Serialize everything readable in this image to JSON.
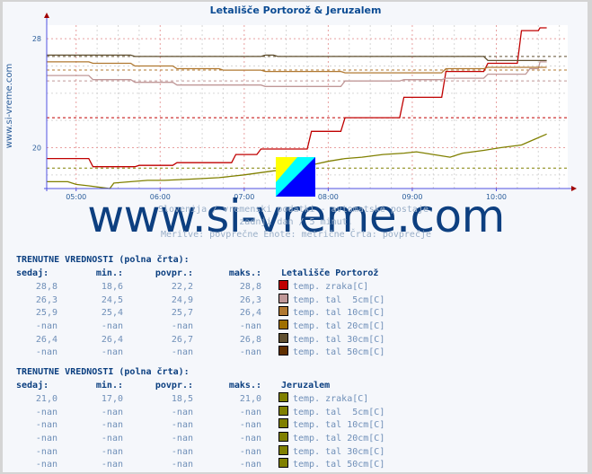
{
  "chart_data": {
    "type": "line",
    "title": "Letališče Portorož & Jeruzalem",
    "side_label": "www.si-vreme.com",
    "xlabel": "",
    "ylabel": "",
    "x_ticks": [
      "05:00",
      "06:00",
      "07:00",
      "08:00",
      "09:00",
      "10:00"
    ],
    "x_range_hours": [
      4.65,
      10.6
    ],
    "y_ticks": [
      20,
      28
    ],
    "ylim": [
      17,
      29
    ],
    "grid": true,
    "series": [
      {
        "name": "Letališče Portorož temp. zraka[C]",
        "color": "#c00000",
        "avg": 22.2,
        "points": [
          [
            4.65,
            19.2
          ],
          [
            5.15,
            19.2
          ],
          [
            5.2,
            18.6
          ],
          [
            5.7,
            18.6
          ],
          [
            5.75,
            18.7
          ],
          [
            6.15,
            18.7
          ],
          [
            6.2,
            18.9
          ],
          [
            6.85,
            18.9
          ],
          [
            6.9,
            19.5
          ],
          [
            7.15,
            19.5
          ],
          [
            7.2,
            19.9
          ],
          [
            7.75,
            19.9
          ],
          [
            7.8,
            21.2
          ],
          [
            8.15,
            21.2
          ],
          [
            8.2,
            22.2
          ],
          [
            8.85,
            22.2
          ],
          [
            8.9,
            23.7
          ],
          [
            9.35,
            23.7
          ],
          [
            9.4,
            25.6
          ],
          [
            9.85,
            25.6
          ],
          [
            9.9,
            26.2
          ],
          [
            10.25,
            26.2
          ],
          [
            10.3,
            28.6
          ],
          [
            10.5,
            28.6
          ],
          [
            10.52,
            28.8
          ],
          [
            10.6,
            28.8
          ]
        ]
      },
      {
        "name": "Letališče Portorož temp. tal 5cm[C]",
        "color": "#c09898",
        "avg": 24.9,
        "points": [
          [
            4.65,
            25.3
          ],
          [
            5.15,
            25.3
          ],
          [
            5.2,
            25.0
          ],
          [
            5.65,
            25.0
          ],
          [
            5.7,
            24.8
          ],
          [
            6.15,
            24.8
          ],
          [
            6.2,
            24.6
          ],
          [
            7.2,
            24.6
          ],
          [
            7.25,
            24.5
          ],
          [
            8.15,
            24.5
          ],
          [
            8.2,
            24.9
          ],
          [
            8.85,
            24.9
          ],
          [
            8.9,
            25.0
          ],
          [
            9.35,
            25.0
          ],
          [
            9.4,
            25.1
          ],
          [
            9.85,
            25.1
          ],
          [
            9.9,
            25.4
          ],
          [
            10.35,
            25.4
          ],
          [
            10.4,
            25.8
          ],
          [
            10.5,
            25.8
          ],
          [
            10.52,
            26.3
          ],
          [
            10.6,
            26.3
          ]
        ]
      },
      {
        "name": "Letališče Portorož temp. tal 10cm[C]",
        "color": "#b07830",
        "avg": 25.7,
        "points": [
          [
            4.65,
            26.3
          ],
          [
            5.15,
            26.3
          ],
          [
            5.2,
            26.2
          ],
          [
            5.65,
            26.2
          ],
          [
            5.7,
            26.0
          ],
          [
            6.15,
            26.0
          ],
          [
            6.2,
            25.8
          ],
          [
            6.7,
            25.8
          ],
          [
            6.75,
            25.7
          ],
          [
            7.2,
            25.7
          ],
          [
            7.25,
            25.6
          ],
          [
            8.15,
            25.6
          ],
          [
            8.2,
            25.5
          ],
          [
            9.35,
            25.5
          ],
          [
            9.4,
            25.8
          ],
          [
            9.85,
            25.8
          ],
          [
            9.9,
            25.9
          ],
          [
            10.6,
            25.9
          ]
        ]
      },
      {
        "name": "Letališče Portorož temp. tal 20cm[C]",
        "color": "#a07000",
        "avg": null,
        "points": []
      },
      {
        "name": "Letališče Portorož temp. tal 30cm[C]",
        "color": "#605030",
        "avg": 26.7,
        "points": [
          [
            4.65,
            26.8
          ],
          [
            5.65,
            26.8
          ],
          [
            5.7,
            26.7
          ],
          [
            7.2,
            26.7
          ],
          [
            7.25,
            26.8
          ],
          [
            7.35,
            26.8
          ],
          [
            7.4,
            26.7
          ],
          [
            9.85,
            26.7
          ],
          [
            9.9,
            26.4
          ],
          [
            10.35,
            26.4
          ],
          [
            10.4,
            26.4
          ],
          [
            10.6,
            26.4
          ]
        ]
      },
      {
        "name": "Letališče Portorož temp. tal 50cm[C]",
        "color": "#603000",
        "avg": null,
        "points": []
      },
      {
        "name": "Jeruzalem temp. zraka[C]",
        "color": "#808000",
        "avg": 18.5,
        "points": [
          [
            4.65,
            17.5
          ],
          [
            4.9,
            17.5
          ],
          [
            5.0,
            17.3
          ],
          [
            5.15,
            17.2
          ],
          [
            5.4,
            17.0
          ],
          [
            5.45,
            17.4
          ],
          [
            5.65,
            17.5
          ],
          [
            5.85,
            17.6
          ],
          [
            6.05,
            17.6
          ],
          [
            6.4,
            17.7
          ],
          [
            6.7,
            17.8
          ],
          [
            7.0,
            18.0
          ],
          [
            7.35,
            18.3
          ],
          [
            7.5,
            18.4
          ],
          [
            7.7,
            18.6
          ],
          [
            7.85,
            18.8
          ],
          [
            8.0,
            19.0
          ],
          [
            8.2,
            19.2
          ],
          [
            8.4,
            19.3
          ],
          [
            8.65,
            19.5
          ],
          [
            8.9,
            19.6
          ],
          [
            9.05,
            19.7
          ],
          [
            9.25,
            19.5
          ],
          [
            9.45,
            19.3
          ],
          [
            9.6,
            19.6
          ],
          [
            9.85,
            19.8
          ],
          [
            10.05,
            20.0
          ],
          [
            10.3,
            20.2
          ],
          [
            10.45,
            20.6
          ],
          [
            10.6,
            21.0
          ]
        ]
      },
      {
        "name": "Jeruzalem temp. tal 5cm[C]",
        "color": "#808000",
        "avg": null,
        "points": []
      },
      {
        "name": "Jeruzalem temp. tal 10cm[C]",
        "color": "#808000",
        "avg": null,
        "points": []
      },
      {
        "name": "Jeruzalem temp. tal 20cm[C]",
        "color": "#808000",
        "avg": null,
        "points": []
      },
      {
        "name": "Jeruzalem temp. tal 30cm[C]",
        "color": "#808000",
        "avg": null,
        "points": []
      },
      {
        "name": "Jeruzalem temp. tal 50cm[C]",
        "color": "#808000",
        "avg": null,
        "points": []
      }
    ]
  },
  "watermark": "www.si-vreme.com",
  "subtitle_lines": [
    "Slovenija / vremenski podatki - avtomatske postaje.",
    "zadnji dan / 5 minut.",
    "Meritve: povprečne  Enote: metrične  Črta: povprečje"
  ],
  "tables": [
    {
      "heading": "TRENUTNE VREDNOSTI (polna črta):",
      "columns": [
        "sedaj:",
        "min.:",
        "povpr.:",
        "maks.:"
      ],
      "station": "Letališče Portorož",
      "rows": [
        {
          "sedaj": "28,8",
          "min": "18,6",
          "povpr": "22,2",
          "maks": "28,8",
          "color": "#c00000",
          "label": "temp. zraka[C]"
        },
        {
          "sedaj": "26,3",
          "min": "24,5",
          "povpr": "24,9",
          "maks": "26,3",
          "color": "#c09898",
          "label": "temp. tal  5cm[C]"
        },
        {
          "sedaj": "25,9",
          "min": "25,4",
          "povpr": "25,7",
          "maks": "26,4",
          "color": "#b07830",
          "label": "temp. tal 10cm[C]"
        },
        {
          "sedaj": "-nan",
          "min": "-nan",
          "povpr": "-nan",
          "maks": "-nan",
          "color": "#a07000",
          "label": "temp. tal 20cm[C]"
        },
        {
          "sedaj": "26,4",
          "min": "26,4",
          "povpr": "26,7",
          "maks": "26,8",
          "color": "#605030",
          "label": "temp. tal 30cm[C]"
        },
        {
          "sedaj": "-nan",
          "min": "-nan",
          "povpr": "-nan",
          "maks": "-nan",
          "color": "#603000",
          "label": "temp. tal 50cm[C]"
        }
      ]
    },
    {
      "heading": "TRENUTNE VREDNOSTI (polna črta):",
      "columns": [
        "sedaj:",
        "min.:",
        "povpr.:",
        "maks.:"
      ],
      "station": "Jeruzalem",
      "rows": [
        {
          "sedaj": "21,0",
          "min": "17,0",
          "povpr": "18,5",
          "maks": "21,0",
          "color": "#808000",
          "label": "temp. zraka[C]"
        },
        {
          "sedaj": "-nan",
          "min": "-nan",
          "povpr": "-nan",
          "maks": "-nan",
          "color": "#808000",
          "label": "temp. tal  5cm[C]"
        },
        {
          "sedaj": "-nan",
          "min": "-nan",
          "povpr": "-nan",
          "maks": "-nan",
          "color": "#808000",
          "label": "temp. tal 10cm[C]"
        },
        {
          "sedaj": "-nan",
          "min": "-nan",
          "povpr": "-nan",
          "maks": "-nan",
          "color": "#808000",
          "label": "temp. tal 20cm[C]"
        },
        {
          "sedaj": "-nan",
          "min": "-nan",
          "povpr": "-nan",
          "maks": "-nan",
          "color": "#808000",
          "label": "temp. tal 30cm[C]"
        },
        {
          "sedaj": "-nan",
          "min": "-nan",
          "povpr": "-nan",
          "maks": "-nan",
          "color": "#808000",
          "label": "temp. tal 50cm[C]"
        }
      ]
    }
  ]
}
